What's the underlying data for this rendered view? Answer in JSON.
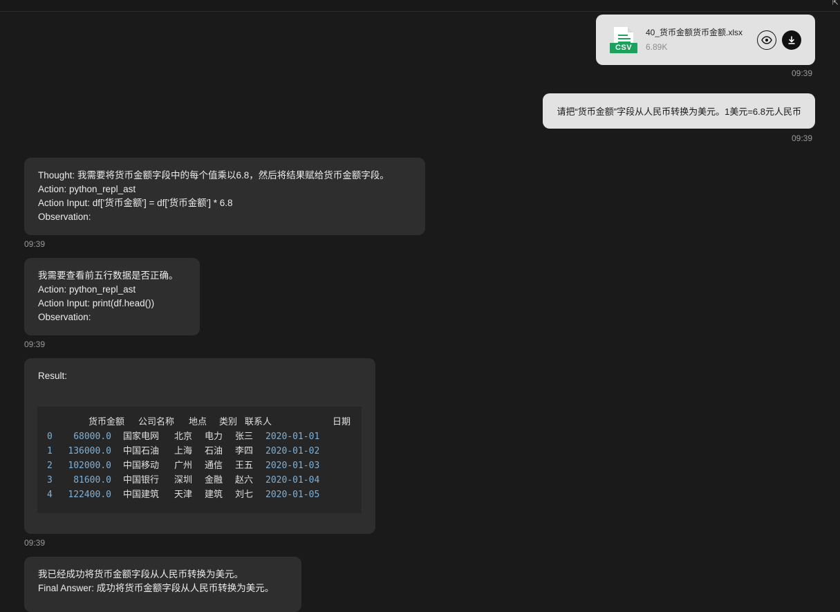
{
  "file": {
    "name": "40_货币金额货币金额.xlsx",
    "size": "6.89K",
    "badge": "CSV",
    "accent": "#1fa15e"
  },
  "messages": {
    "file_time": "09:39",
    "user_text": "请把“货币金额”字段从人民币转换为美元。1美元=6.8元人民币",
    "user_time": "09:39",
    "bot1": {
      "lines": [
        "Thought: 我需要将货币金额字段中的每个值乘以6.8，然后将结果赋给货币金额字段。",
        "Action: python_repl_ast",
        "Action Input: df['货币金额'] = df['货币金额'] * 6.8",
        "Observation:"
      ],
      "time": "09:39"
    },
    "bot2": {
      "lines": [
        "我需要查看前五行数据是否正确。",
        "Action: python_repl_ast",
        "Action Input: print(df.head())",
        "Observation:"
      ],
      "time": "09:39"
    },
    "bot3": {
      "label": "Result:",
      "headers": [
        "货币金额",
        "公司名称",
        "地点",
        "类别",
        "联系人",
        "日期"
      ],
      "rows": [
        [
          "0",
          "68000.0",
          "国家电网",
          "北京",
          "电力",
          "张三",
          "2020-01-01"
        ],
        [
          "1",
          "136000.0",
          "中国石油",
          "上海",
          "石油",
          "李四",
          "2020-01-02"
        ],
        [
          "2",
          "102000.0",
          "中国移动",
          "广州",
          "通信",
          "王五",
          "2020-01-03"
        ],
        [
          "3",
          "81600.0",
          "中国银行",
          "深圳",
          "金融",
          "赵六",
          "2020-01-04"
        ],
        [
          "4",
          "122400.0",
          "中国建筑",
          "天津",
          "建筑",
          "刘七",
          "2020-01-05"
        ]
      ],
      "time": "09:39"
    },
    "bot4": {
      "lines": [
        "我已经成功将货币金额字段从人民币转换为美元。",
        "Final Answer: 成功将货币金额字段从人民币转换为美元。"
      ]
    }
  },
  "icons": {
    "preview": "eye-icon",
    "download": "download-icon",
    "corner": "external-link-icon"
  }
}
